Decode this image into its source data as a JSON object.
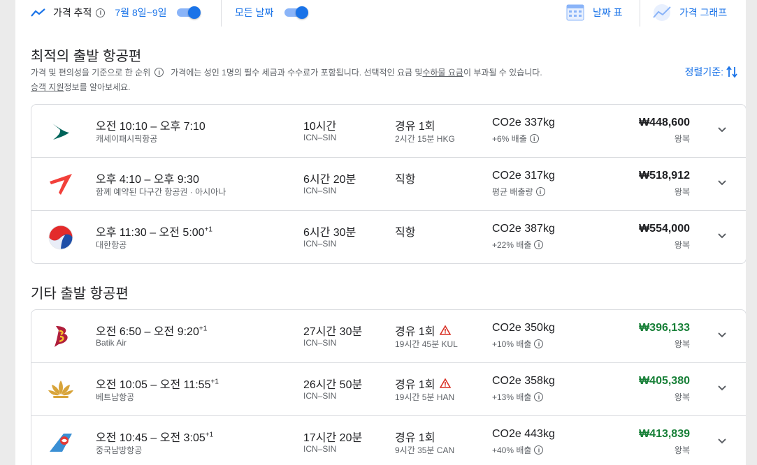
{
  "topbar": {
    "price_tracking_label": "가격 추적",
    "price_tracking_dates": "7월 8일~9일",
    "all_dates_label": "모든 날짜",
    "date_grid_label": "날짜 표",
    "price_graph_label": "가격 그래프"
  },
  "best": {
    "title": "최적의 출발 항공편",
    "subtitle_ranked": "가격 및 편의성을 기준으로 한 순위",
    "subtitle_taxes_pre": "가격에는 성인 1명의 필수 세금과 수수료가 포함됩니다. 선택적인 요금 및 ",
    "subtitle_baggage_link": "수하물 요금",
    "subtitle_taxes_post": "이 부과될 수 있습니다.",
    "passenger_link": "승객 지원",
    "passenger_post": " 정보를 알아보세요.",
    "sort_label": "정렬기준:",
    "flights": [
      {
        "dep": "오전 10:10",
        "arr": "오후 7:10",
        "plus": "",
        "airline": "캐세이패시픽항공",
        "duration": "10시간",
        "route": "ICN–SIN",
        "stops": "경유 1회",
        "layover": "2시간 15분 HKG",
        "co2": "CO2e 337kg",
        "co2_note": "+6% 배출",
        "price": "₩448,600",
        "trip": "왕복"
      },
      {
        "dep": "오후 4:10",
        "arr": "오후 9:30",
        "plus": "",
        "airline": "함께 예약된 다구간 항공권 · 아시아나",
        "duration": "6시간 20분",
        "route": "ICN–SIN",
        "stops": "직항",
        "layover": "",
        "co2": "CO2e 317kg",
        "co2_note": "평균 배출량",
        "price": "₩518,912",
        "trip": "왕복"
      },
      {
        "dep": "오후 11:30",
        "arr": "오전 5:00",
        "plus": "+1",
        "airline": "대한항공",
        "duration": "6시간 30분",
        "route": "ICN–SIN",
        "stops": "직항",
        "layover": "",
        "co2": "CO2e 387kg",
        "co2_note": "+22% 배출",
        "price": "₩554,000",
        "trip": "왕복"
      }
    ]
  },
  "other": {
    "title": "기타 출발 항공편",
    "flights": [
      {
        "dep": "오전 6:50",
        "arr": "오전 9:20",
        "plus": "+1",
        "airline": "Batik Air",
        "duration": "27시간 30분",
        "route": "ICN–SIN",
        "stops": "경유 1회",
        "layover": "19시간 45분 KUL",
        "co2": "CO2e 350kg",
        "co2_note": "+10% 배출",
        "price": "₩396,133",
        "trip": "왕복"
      },
      {
        "dep": "오전 10:05",
        "arr": "오전 11:55",
        "plus": "+1",
        "airline": "베트남항공",
        "duration": "26시간 50분",
        "route": "ICN–SIN",
        "stops": "경유 1회",
        "layover": "19시간 5분 HAN",
        "co2": "CO2e 358kg",
        "co2_note": "+13% 배출",
        "price": "₩405,380",
        "trip": "왕복"
      },
      {
        "dep": "오전 10:45",
        "arr": "오전 3:05",
        "plus": "+1",
        "airline": "중국남방항공",
        "duration": "17시간 20분",
        "route": "ICN–SIN",
        "stops": "경유 1회",
        "layover": "9시간 35분 CAN",
        "co2": "CO2e 443kg",
        "co2_note": "+40% 배출",
        "price": "₩413,839",
        "trip": "왕복"
      }
    ]
  }
}
